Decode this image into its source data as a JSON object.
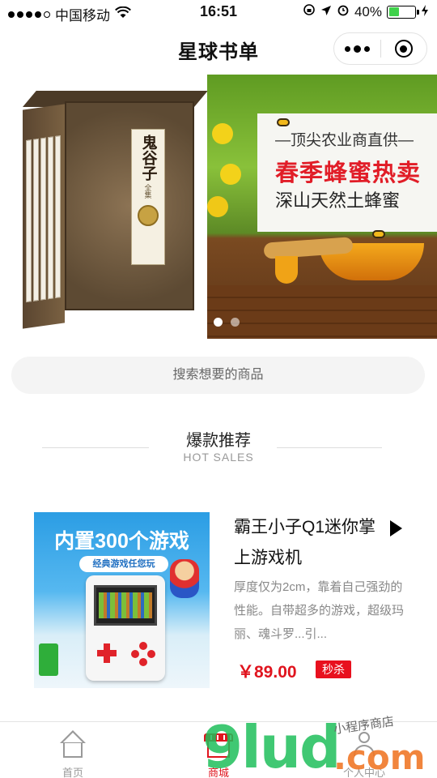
{
  "status_bar": {
    "carrier": "中国移动",
    "time": "16:51",
    "battery": "40%",
    "battery_level": 0.4
  },
  "navbar": {
    "title": "星球书单"
  },
  "banner": {
    "slide_count": 2,
    "active_slide": 0,
    "honey_ad": {
      "line1": "—顶尖农业商直供—",
      "line2": "春季蜂蜜热卖",
      "line3": "深山天然土蜂蜜"
    },
    "book_cover": {
      "title": "鬼谷子",
      "subtitle": "全集"
    }
  },
  "search": {
    "placeholder": "搜索想要的商品"
  },
  "section": {
    "title_cn": "爆款推荐",
    "title_en": "HOT SALES"
  },
  "product": {
    "image_caption": "内置300个游戏",
    "image_pill": "经典游戏任您玩",
    "title": "霸王小子Q1迷你掌上游戏机",
    "description": "厚度仅为2cm，靠着自己强劲的性能。自带超多的游戏，超级玛丽、魂斗罗...引...",
    "price": "￥89.00",
    "tag": "秒杀"
  },
  "tabbar": {
    "tabs": [
      {
        "label": "首页",
        "icon": "home-icon",
        "active": false
      },
      {
        "label": "商城",
        "icon": "shop-icon",
        "active": true
      },
      {
        "label": "个人中心",
        "icon": "user-icon",
        "active": false
      }
    ]
  },
  "watermark": {
    "logo": "9lud",
    "domain": ".com",
    "tagline": "小程序商店"
  },
  "colors": {
    "accent": "#e0141e",
    "inactive": "#999999",
    "search_bg": "#f4f4f4"
  }
}
